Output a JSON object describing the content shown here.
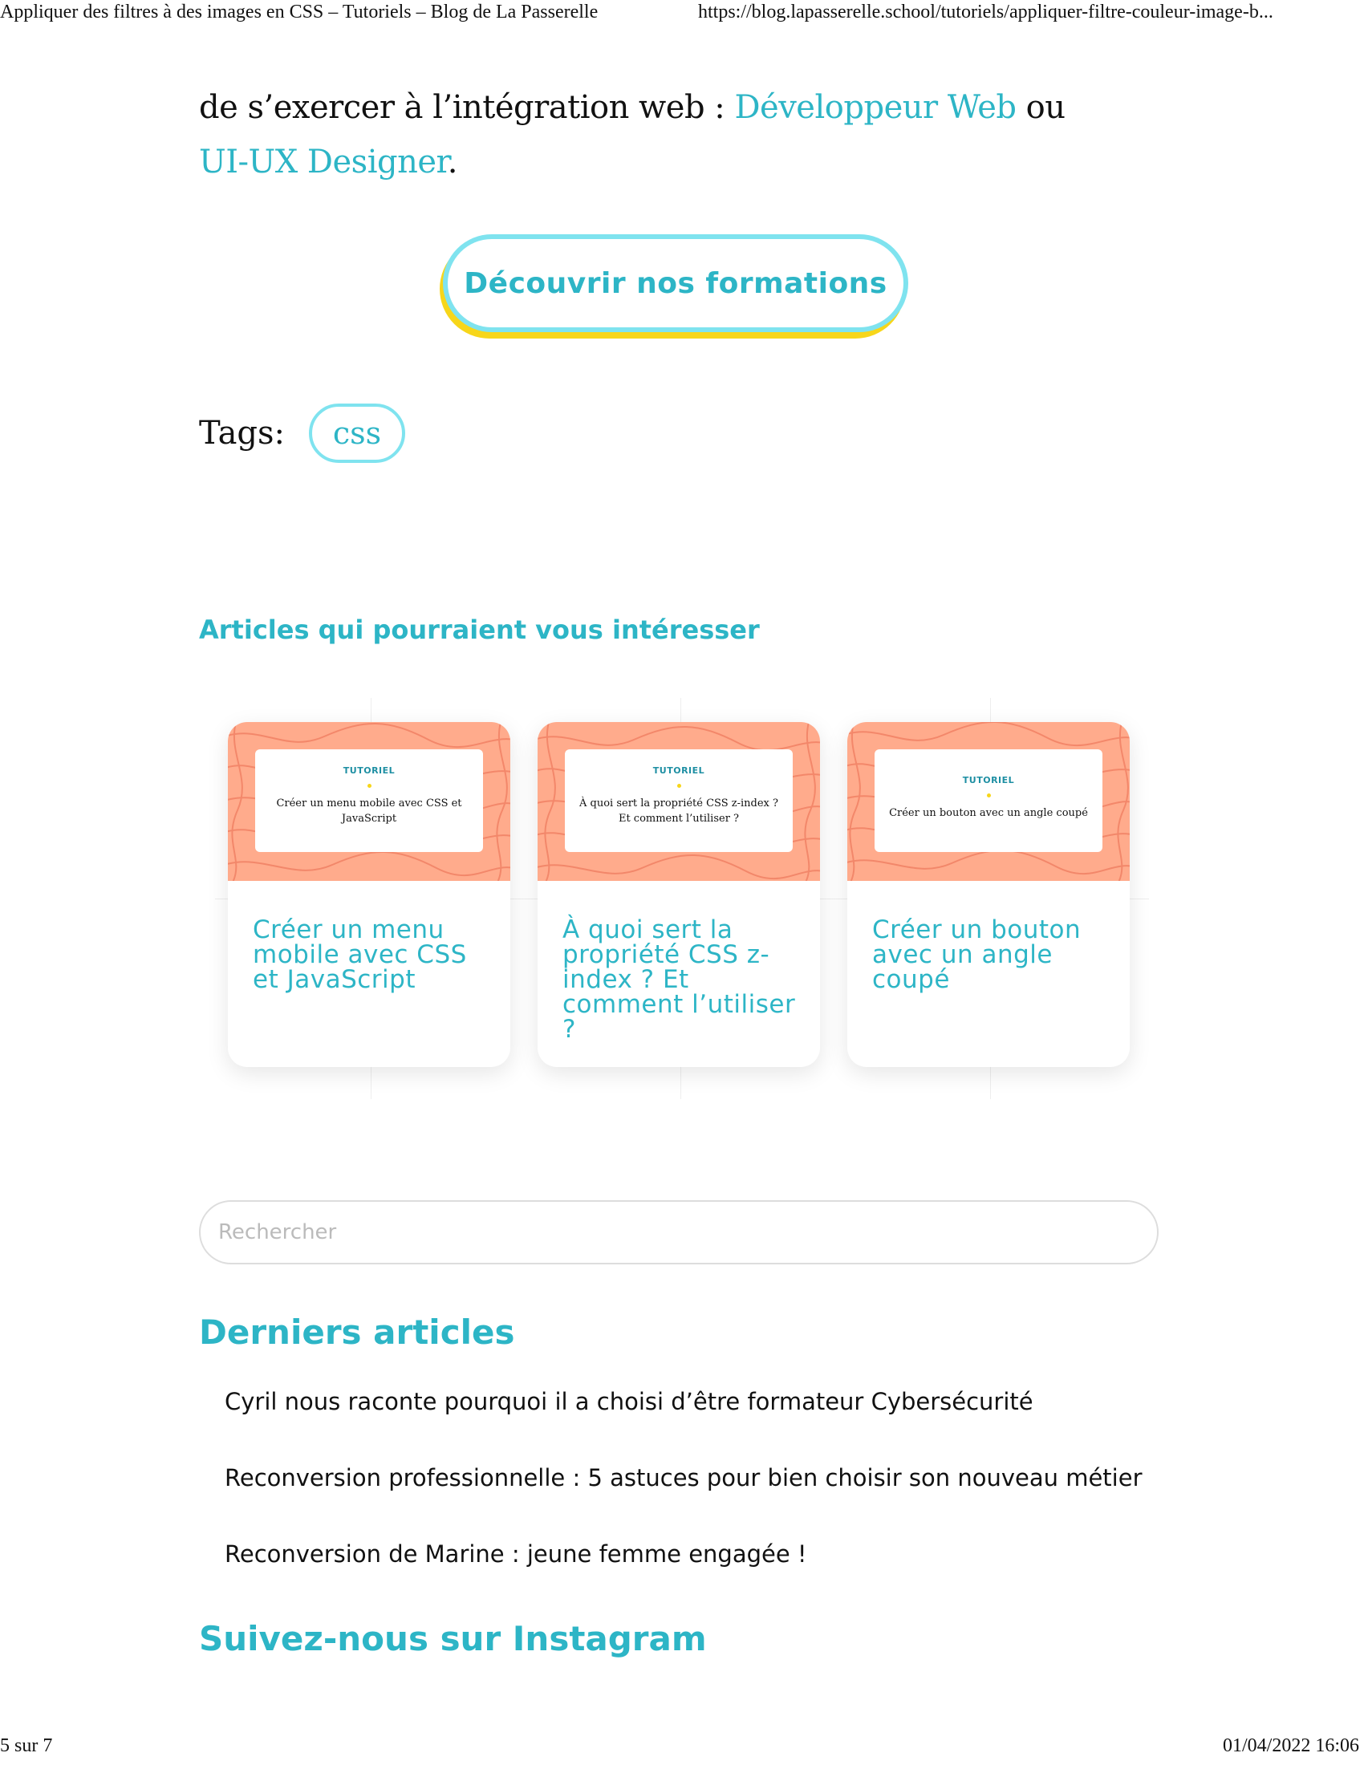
{
  "print_header": {
    "title": "Appliquer des filtres à des images en CSS – Tutoriels – Blog de La Passerelle",
    "url": "https://blog.lapasserelle.school/tutoriels/appliquer-filtre-couleur-image-b..."
  },
  "intro": {
    "text_before": "de s’exercer à l’intégration web : ",
    "link_1": "Développeur Web",
    "text_middle": " ou ",
    "link_2": "UI-UX Designer",
    "text_after": "."
  },
  "cta": {
    "label": "Découvrir nos formations"
  },
  "tags": {
    "label": "Tags:",
    "items": [
      "css"
    ]
  },
  "related": {
    "heading": "Articles qui pourraient vous intéresser",
    "cards": [
      {
        "image_kicker": "TUTORIEL",
        "image_title": "Créer un menu mobile avec CSS et JavaScript",
        "title": "Créer un menu mobile avec CSS et JavaScript"
      },
      {
        "image_kicker": "TUTORIEL",
        "image_title": "À quoi sert la propriété CSS z-index ? Et comment l’utiliser ?",
        "title": "À quoi sert la propriété CSS z-index ? Et comment l’utiliser ?"
      },
      {
        "image_kicker": "TUTORIEL",
        "image_title": "Créer un bouton avec un angle coupé",
        "title": "Créer un bouton avec un angle coupé"
      }
    ]
  },
  "search": {
    "placeholder": "Rechercher",
    "value": ""
  },
  "latest": {
    "heading": "Derniers articles",
    "items": [
      "Cyril nous raconte pourquoi il a choisi d’être formateur Cybersécurité",
      "Reconversion professionnelle : 5 astuces pour bien choisir son nouveau métier",
      "Reconversion de Marine : jeune femme engagée !"
    ]
  },
  "instagram": {
    "heading": "Suivez-nous sur Instagram"
  },
  "print_footer": {
    "page": "5 sur 7",
    "datetime": "01/04/2022 16:06"
  },
  "colors": {
    "accent": "#2db5c6",
    "pill_border": "#7fe3ef",
    "cta_shadow": "#f7d61a",
    "card_image_bg": "#ffab8c",
    "card_pattern": "#f07f62"
  }
}
